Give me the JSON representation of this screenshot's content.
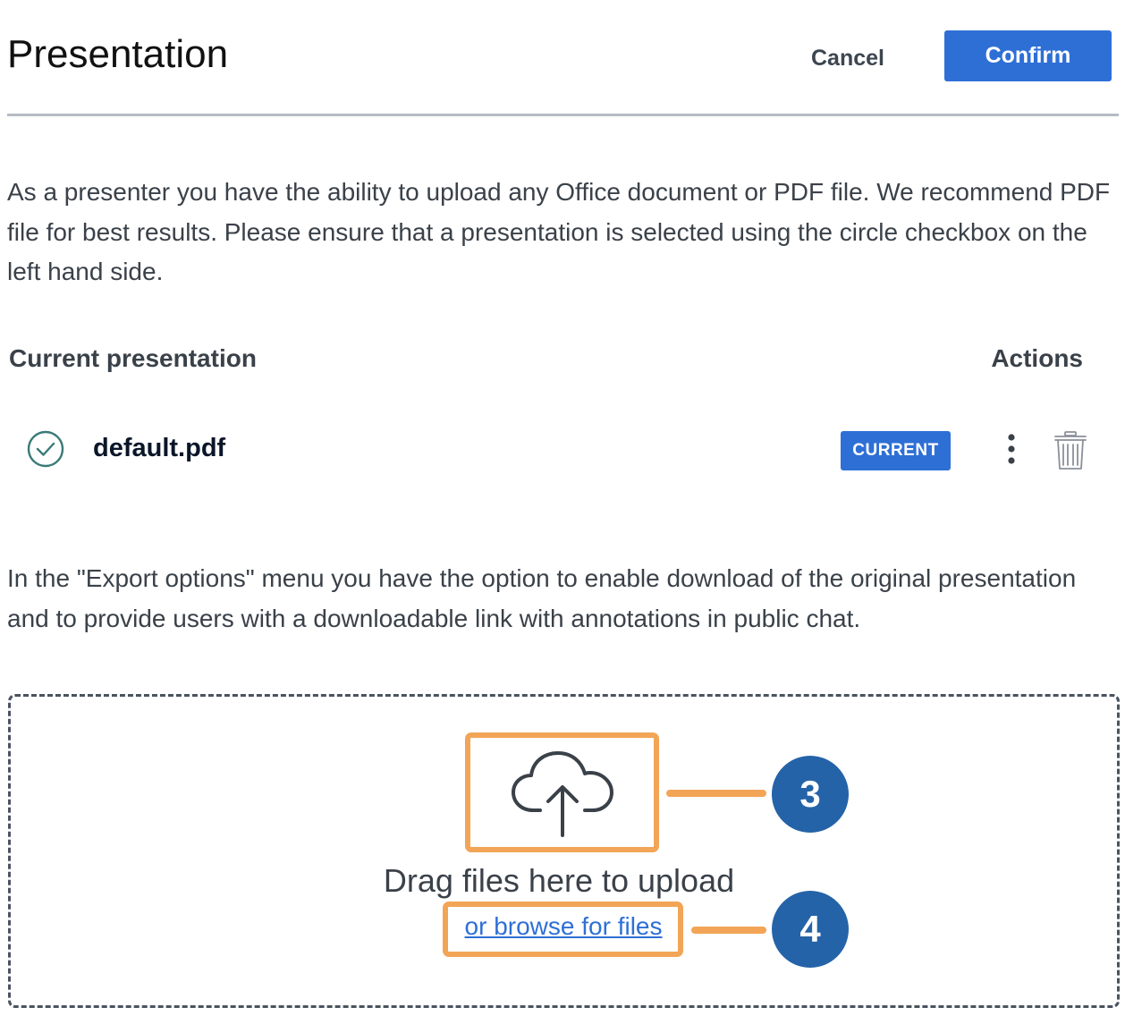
{
  "header": {
    "title": "Presentation",
    "cancel_label": "Cancel",
    "confirm_label": "Confirm"
  },
  "intro_text": "As a presenter you have the ability to upload any Office document or PDF file. We recommend PDF file for best results. Please ensure that a presentation is selected using the circle checkbox on the left hand side.",
  "table": {
    "col_current": "Current presentation",
    "col_actions": "Actions",
    "rows": [
      {
        "filename": "default.pdf",
        "status_badge": "CURRENT",
        "selected": true
      }
    ]
  },
  "export_text": "In the \"Export options\" menu you have the option to enable download of the original presentation and to provide users with a downloadable link with annotations in public chat.",
  "dropzone": {
    "drag_text": "Drag files here to upload",
    "browse_link": "or browse for files"
  },
  "callouts": [
    {
      "number": "3",
      "target": "upload-icon"
    },
    {
      "number": "4",
      "target": "browse-link"
    }
  ],
  "colors": {
    "accent": "#2e6fd6",
    "highlight": "#f2a556",
    "callout": "#2563a8",
    "check": "#3a7a78"
  },
  "icons": {
    "selected": "check-circle-icon",
    "more": "kebab-menu-icon",
    "delete": "trash-icon",
    "upload": "cloud-upload-icon"
  }
}
